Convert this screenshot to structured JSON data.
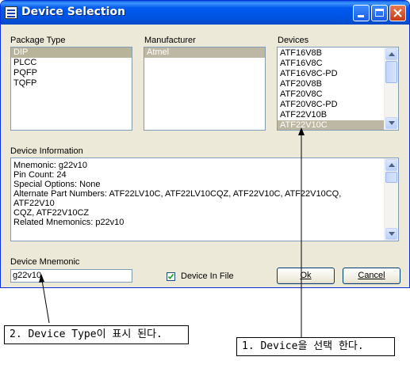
{
  "window": {
    "title": "Device Selection"
  },
  "package_type": {
    "label": "Package Type",
    "items": [
      "DIP",
      "PLCC",
      "PQFP",
      "TQFP"
    ],
    "selected": "DIP"
  },
  "manufacturer": {
    "label": "Manufacturer",
    "items": [
      "Atmel"
    ],
    "selected": "Atmel"
  },
  "devices": {
    "label": "Devices",
    "items": [
      "ATF16V8B",
      "ATF16V8C",
      "ATF16V8C-PD",
      "ATF20V8B",
      "ATF20V8C",
      "ATF20V8C-PD",
      "ATF22V10B",
      "ATF22V10C"
    ],
    "selected": "ATF22V10C"
  },
  "device_information": {
    "label": "Device Information",
    "lines": [
      "Mnemonic:  g22v10",
      "Pin Count:  24",
      "Special Options:  None",
      "Alternate Part Numbers:  ATF22LV10C, ATF22LV10CQZ, ATF22V10C, ATF22V10CQ, ATF22V10",
      "CQZ, ATF22V10CZ",
      "Related Mnemonics:  p22v10"
    ]
  },
  "device_mnemonic": {
    "label": "Device Mnemonic",
    "value": "g22v10"
  },
  "device_in_file": {
    "label": "Device In File",
    "checked": true
  },
  "buttons": {
    "ok": "Ok",
    "cancel": "Cancel"
  },
  "annotations": {
    "note2": "2. Device Type이 표시 된다.",
    "note1": "1. Device을 선택 한다."
  }
}
